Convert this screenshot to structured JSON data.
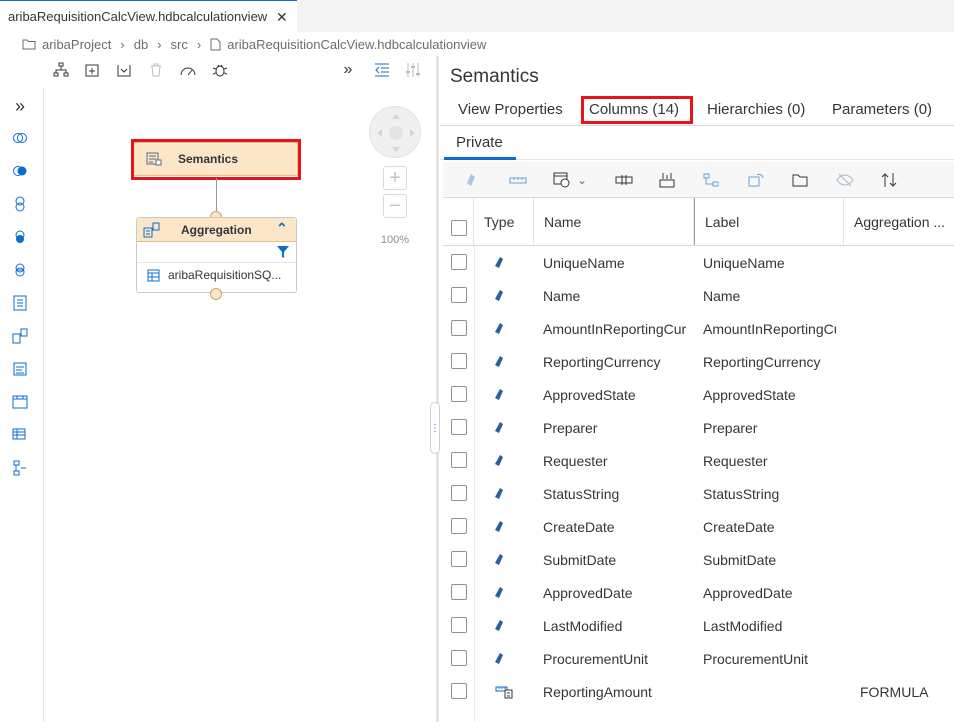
{
  "tab": {
    "title": "aribaRequisitionCalcView.hdbcalculationview",
    "close": "✕"
  },
  "breadcrumb": [
    "ariba",
    "Project",
    "db",
    "src",
    "aribaRequisitionCalcView.hdbcalculationview"
  ],
  "canvas": {
    "semantics_node": "Semantics",
    "aggregation_node": "Aggregation",
    "aggregation_source": "aribaRequisitionSQ...",
    "zoom_level": "100%"
  },
  "right_panel": {
    "title": "Semantics",
    "tabs": [
      "View Properties",
      "Columns (14)",
      "Hierarchies (0)",
      "Parameters (0)"
    ],
    "subtab": "Private",
    "table": {
      "headers": {
        "type": "Type",
        "name": "Name",
        "label": "Label",
        "aggregation": "Aggregation ..."
      },
      "rows": [
        {
          "name": "UniqueName",
          "label": "UniqueName",
          "aggregation": "",
          "type_icon": "attribute-icon"
        },
        {
          "name": "Name",
          "label": "Name",
          "aggregation": "",
          "type_icon": "attribute-icon"
        },
        {
          "name": "AmountInReportingCur",
          "label": "AmountInReportingCu",
          "aggregation": "",
          "type_icon": "attribute-icon"
        },
        {
          "name": "ReportingCurrency",
          "label": "ReportingCurrency",
          "aggregation": "",
          "type_icon": "attribute-icon"
        },
        {
          "name": "ApprovedState",
          "label": "ApprovedState",
          "aggregation": "",
          "type_icon": "attribute-icon"
        },
        {
          "name": "Preparer",
          "label": "Preparer",
          "aggregation": "",
          "type_icon": "attribute-icon"
        },
        {
          "name": "Requester",
          "label": "Requester",
          "aggregation": "",
          "type_icon": "attribute-icon"
        },
        {
          "name": "StatusString",
          "label": "StatusString",
          "aggregation": "",
          "type_icon": "attribute-icon"
        },
        {
          "name": "CreateDate",
          "label": "CreateDate",
          "aggregation": "",
          "type_icon": "attribute-icon"
        },
        {
          "name": "SubmitDate",
          "label": "SubmitDate",
          "aggregation": "",
          "type_icon": "attribute-icon"
        },
        {
          "name": "ApprovedDate",
          "label": "ApprovedDate",
          "aggregation": "",
          "type_icon": "attribute-icon"
        },
        {
          "name": "LastModified",
          "label": "LastModified",
          "aggregation": "",
          "type_icon": "attribute-icon"
        },
        {
          "name": "ProcurementUnit",
          "label": "ProcurementUnit",
          "aggregation": "",
          "type_icon": "attribute-icon"
        },
        {
          "name": "ReportingAmount",
          "label": "",
          "aggregation": "FORMULA",
          "type_icon": "measure-icon"
        }
      ]
    }
  },
  "colors": {
    "highlight_box": "#e8141a",
    "accent": "#0a6ed1",
    "node_fill": "#fbe6c8"
  }
}
